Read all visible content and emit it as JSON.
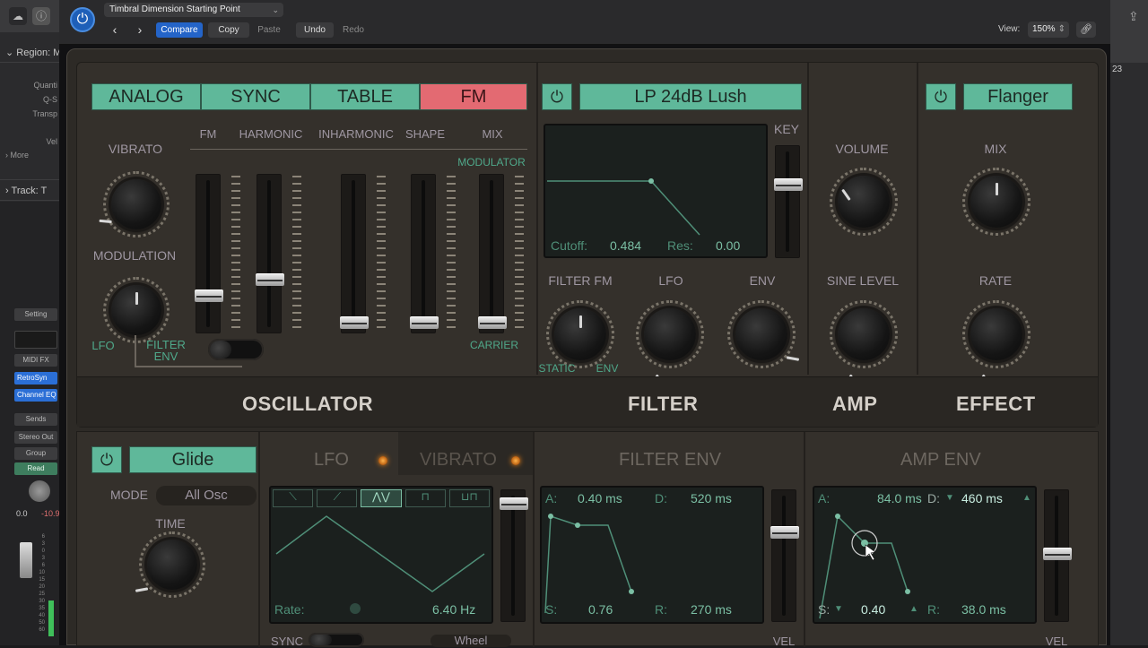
{
  "daw_left": {
    "region_label": "Region: M",
    "quantize": "Quanti",
    "q_swing": "Q-S",
    "transpose": "Transp",
    "velocity": "Vel",
    "more": "More",
    "track_label": "Track: T",
    "setting": "Setting",
    "midi_fx": "MIDI FX",
    "instrument": "RetroSyn",
    "channel_eq": "Channel EQ",
    "sends": "Sends",
    "output": "Stereo Out",
    "group": "Group",
    "automation": "Read",
    "pan_value": "0.0",
    "level_value": "-10.9",
    "meter_scale": [
      "6",
      "3",
      "0",
      "3",
      "6",
      "10",
      "15",
      "20",
      "25",
      "30",
      "35",
      "40",
      "50",
      "60"
    ]
  },
  "daw_right": {
    "ruler": "23"
  },
  "header": {
    "preset_name": "Timbral Dimension Starting Point",
    "compare": "Compare",
    "copy": "Copy",
    "paste": "Paste",
    "undo": "Undo",
    "redo": "Redo",
    "view_label": "View:",
    "view_value": "150%",
    "nav_prev": "‹",
    "nav_next": "›"
  },
  "oscillator": {
    "tabs": [
      "ANALOG",
      "SYNC",
      "TABLE",
      "FM"
    ],
    "active_tab": "FM",
    "vibrato": "VIBRATO",
    "modulation": "MODULATION",
    "lfo": "LFO",
    "filter_env": "FILTER ENV",
    "fader_labels": [
      "FM",
      "HARMONIC",
      "INHARMONIC",
      "SHAPE",
      "MIX"
    ],
    "modulator": "MODULATOR",
    "carrier": "CARRIER",
    "section": "OSCILLATOR"
  },
  "filter": {
    "type": "LP 24dB Lush",
    "key": "KEY",
    "cutoff_label": "Cutoff:",
    "cutoff_value": "0.484",
    "res_label": "Res:",
    "res_value": "0.00",
    "filter_fm": "FILTER FM",
    "lfo": "LFO",
    "env": "ENV",
    "static": "STATIC",
    "env_small": "ENV",
    "section": "FILTER"
  },
  "amp": {
    "volume": "VOLUME",
    "sine_level": "SINE LEVEL",
    "section": "AMP"
  },
  "effect": {
    "name": "Flanger",
    "mix": "MIX",
    "rate": "RATE",
    "section": "EFFECT"
  },
  "glide": {
    "name": "Glide",
    "mode_label": "MODE",
    "mode_value": "All Osc",
    "time": "TIME"
  },
  "lfo": {
    "title": "LFO",
    "vibrato_title": "VIBRATO",
    "rate_label": "Rate:",
    "rate_value": "6.40 Hz",
    "sync": "SYNC",
    "wheel": "Wheel"
  },
  "filter_env": {
    "title": "FILTER ENV",
    "a_label": "A:",
    "a_value": "0.40 ms",
    "d_label": "D:",
    "d_value": "520 ms",
    "s_label": "S:",
    "s_value": "0.76",
    "r_label": "R:",
    "r_value": "270 ms",
    "vel": "VEL"
  },
  "amp_env": {
    "title": "AMP ENV",
    "a_label": "A:",
    "a_value": "84.0 ms",
    "d_label": "D:",
    "d_value": "460 ms",
    "s_label": "S:",
    "s_value": "0.40",
    "r_label": "R:",
    "r_value": "38.0 ms",
    "vel": "VEL"
  },
  "colors": {
    "accent_green": "#5fb89a",
    "active_red": "#e36a72",
    "compare_blue": "#2464c8"
  }
}
